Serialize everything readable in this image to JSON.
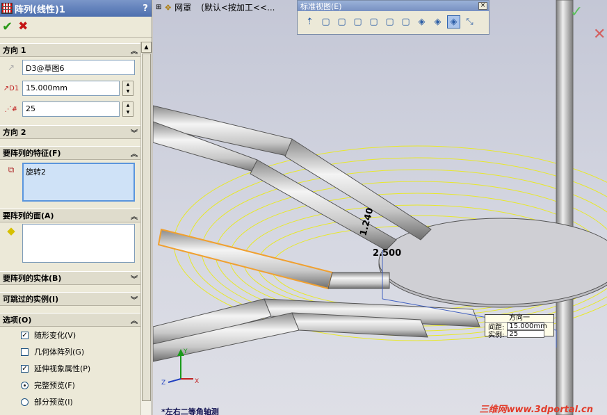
{
  "property_manager": {
    "title": "阵列(线性)1",
    "help": "?",
    "ok_glyph": "✔",
    "cancel_glyph": "✖",
    "direction1": {
      "header": "方向 1",
      "reference": "D3@草图6",
      "spacing": "15.000mm",
      "count": "25"
    },
    "direction2": {
      "header": "方向 2"
    },
    "features": {
      "header": "要阵列的特征(F)",
      "items": [
        "旋转2"
      ]
    },
    "faces": {
      "header": "要阵列的面(A)"
    },
    "bodies": {
      "header": "要阵列的实体(B)"
    },
    "skip": {
      "header": "可跳过的实例(I)"
    },
    "options": {
      "header": "选项(O)",
      "items": [
        {
          "label": "随形变化(V)",
          "type": "checkbox",
          "checked": true
        },
        {
          "label": "几何体阵列(G)",
          "type": "checkbox",
          "checked": false
        },
        {
          "label": "延伸视象属性(P)",
          "type": "checkbox",
          "checked": true
        },
        {
          "label": "完整预览(F)",
          "type": "radio",
          "checked": true
        },
        {
          "label": "部分预览(I)",
          "type": "radio",
          "checked": false
        }
      ]
    }
  },
  "viewport": {
    "tree_head": {
      "item1": "网罩",
      "item2": "(默认<按加工<<..."
    },
    "view_label": "*左右二等角轴测",
    "watermark": "三维网www.3dportal.cn",
    "dimension1": "1.240",
    "dimension2": "2.500",
    "triad": {
      "y": "Y",
      "x": "X",
      "z": "Z"
    }
  },
  "standard_views": {
    "title": "标准视图(E)",
    "close": "×",
    "buttons": [
      "normal-to-icon",
      "front-view-icon",
      "back-view-icon",
      "left-view-icon",
      "right-view-icon",
      "top-view-icon",
      "bottom-view-icon",
      "isometric-view-icon",
      "trimetric-view-icon",
      "view-selector-icon"
    ]
  },
  "callout": {
    "title": "方向一",
    "spacing_label": "间距:",
    "spacing_value": "15.000mm",
    "count_label": "实例:",
    "count_value": "25"
  },
  "colors": {
    "preview_yellow": "#e8e82a",
    "selected_orange": "#f0a030",
    "title_blue": "#4d6fae"
  }
}
